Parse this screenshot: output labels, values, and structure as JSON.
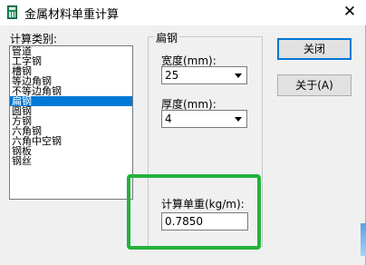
{
  "window": {
    "title": "金属材料单重计算",
    "close_glyph": "✕"
  },
  "calc_type": {
    "label": "计算类别:",
    "items": [
      "管道",
      "工字钢",
      "槽钢",
      "等边角钢",
      "不等边角钢",
      "扁钢",
      "圆钢",
      "方钢",
      "六角钢",
      "六角中空钢",
      "钢板",
      "钢丝"
    ],
    "selected_index": 5
  },
  "group": {
    "title": "扁钢",
    "width_label": "宽度(mm):",
    "width_value": "25",
    "thickness_label": "厚度(mm):",
    "thickness_value": "4",
    "unit_weight_label": "计算单重(kg/m):",
    "unit_weight_value": "0.7850"
  },
  "buttons": {
    "close_label": "关闭",
    "about_label": "关于(A)"
  },
  "colors": {
    "selection": "#0078d7",
    "highlight": "#22b33b"
  }
}
